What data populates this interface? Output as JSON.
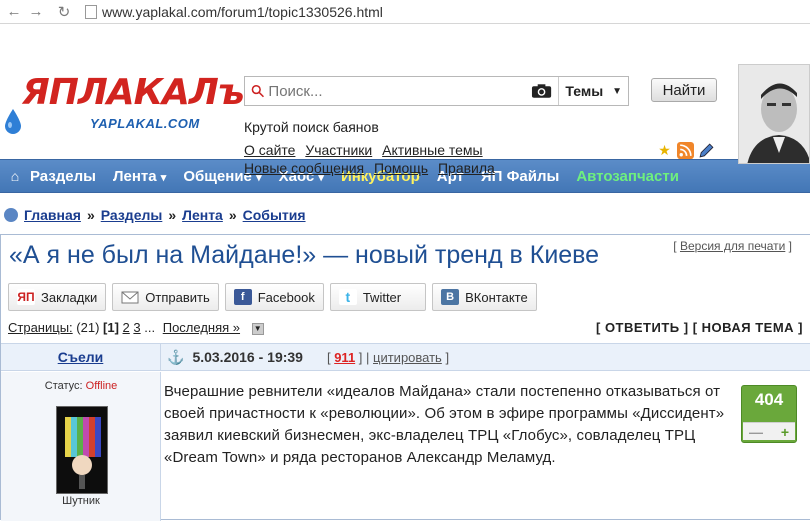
{
  "browser": {
    "url": "www.yaplakal.com/forum1/topic1330526.html"
  },
  "logo": {
    "main": "ЯПЛАКАЛъ",
    "sub": "YAPLAKAL.COM"
  },
  "search": {
    "placeholder": "Поиск...",
    "scope": "Темы",
    "button": "Найти"
  },
  "header": {
    "tagline": "Крутой поиск баянов",
    "links_row1": [
      "О сайте",
      "Участники",
      "Активные темы"
    ],
    "links_row2": [
      "Новые сообщения",
      "Помощь",
      "Правила"
    ]
  },
  "nav": {
    "items": [
      {
        "label": "Разделы",
        "dropdown": false
      },
      {
        "label": "Лента",
        "dropdown": true
      },
      {
        "label": "Общение",
        "dropdown": true
      },
      {
        "label": "Хаос",
        "dropdown": true
      },
      {
        "label": "Инкубатор",
        "dropdown": false
      },
      {
        "label": "Арт",
        "dropdown": false
      },
      {
        "label": "ЯП Файлы",
        "dropdown": false
      },
      {
        "label": "Автозапчасти",
        "dropdown": false
      }
    ],
    "arrow": "▾"
  },
  "breadcrumbs": [
    "Главная",
    "Разделы",
    "Лента",
    "События"
  ],
  "breadcrumb_sep": "»",
  "topic": {
    "title": "«А я не был на Майдане!» — новый тренд в Киеве",
    "print_label": "Версия для печати"
  },
  "share": [
    "Закладки",
    "Отправить",
    "Facebook",
    "Twitter",
    "ВКонтакте"
  ],
  "pagination": {
    "label": "Страницы:",
    "total": "(21)",
    "current": "[1]",
    "pages": [
      "2",
      "3"
    ],
    "ellipsis": "...",
    "last": "Последняя »",
    "reply": "[ ОТВЕТИТЬ ]",
    "new_topic": "[ НОВАЯ ТЕМА ]"
  },
  "post": {
    "author": "Съели",
    "date": "5.03.2016 - 19:39",
    "number": "911",
    "quote": "цитировать",
    "status_label": "Статус:",
    "status": "Offline",
    "rank": "Шутник",
    "rating": "404",
    "minus": "—",
    "plus": "+",
    "body": "Вчерашние ревнители «идеалов Майдана» стали постепенно отказываться от своей причастности к «революции». Об этом в эфире программы «Диссидент» заявил киевский бизнесмен, экс-владелец ТРЦ «Глобус», совладелец ТРЦ «Dream Town» и ряда ресторанов Александр Меламуд.",
    "status_color": "#cc2222",
    "rating_color": "#6aa83b"
  }
}
